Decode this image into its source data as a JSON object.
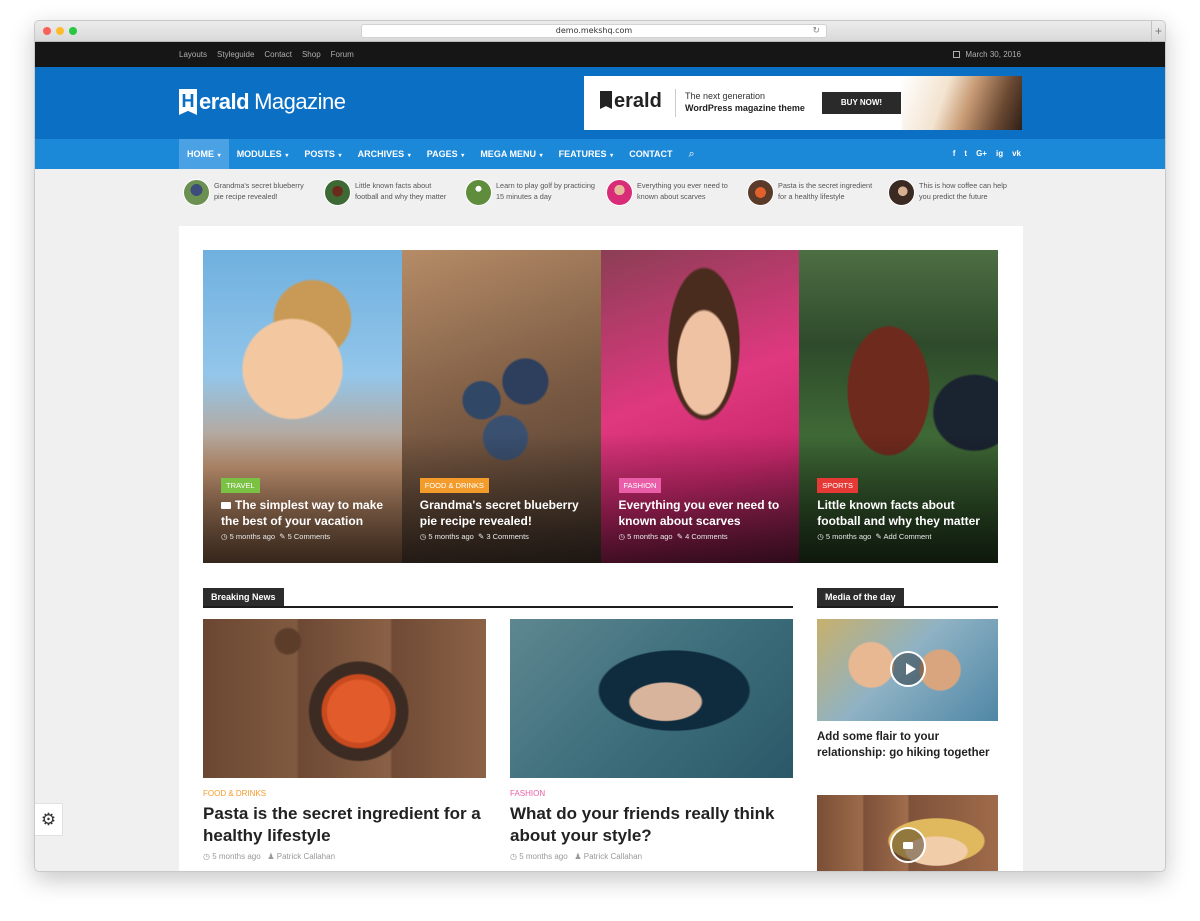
{
  "browser": {
    "url": "demo.mekshq.com"
  },
  "topbar": {
    "links": [
      "Layouts",
      "Styleguide",
      "Contact",
      "Shop",
      "Forum"
    ],
    "date": "March 30, 2016"
  },
  "logo": {
    "mark": "H",
    "word": "erald",
    "suffix": "Magazine"
  },
  "banner": {
    "logo_text": "erald",
    "tagline_1": "The next generation",
    "tagline_2": "WordPress magazine theme",
    "button": "BUY NOW!"
  },
  "nav": {
    "items": [
      "HOME",
      "MODULES",
      "POSTS",
      "ARCHIVES",
      "PAGES",
      "MEGA MENU",
      "FEATURES",
      "CONTACT"
    ],
    "social": [
      "f",
      "t",
      "G+",
      "ig",
      "vk"
    ]
  },
  "ticker": [
    "Grandma's secret blueberry pie recipe revealed!",
    "Little known facts about football and why they matter",
    "Learn to play golf by practicing 15 minutes a day",
    "Everything you ever need to known about scarves",
    "Pasta is the secret ingredient for a healthy lifestyle",
    "This is how coffee can help you predict the future"
  ],
  "featured": [
    {
      "category": "TRAVEL",
      "title": "The simplest way to make the best of your vacation",
      "time": "5 months ago",
      "comments": "5 Comments"
    },
    {
      "category": "FOOD & DRINKS",
      "title": "Grandma's secret blueberry pie recipe revealed!",
      "time": "5 months ago",
      "comments": "3 Comments"
    },
    {
      "category": "FASHION",
      "title": "Everything you ever need to known about scarves",
      "time": "5 months ago",
      "comments": "4 Comments"
    },
    {
      "category": "SPORTS",
      "title": "Little known facts about football and why they matter",
      "time": "5 months ago",
      "comments": "Add Comment"
    }
  ],
  "breaking": {
    "heading": "Breaking News",
    "posts": [
      {
        "category": "FOOD & DRINKS",
        "title": "Pasta is the secret ingredient for a healthy lifestyle",
        "time": "5 months ago",
        "author": "Patrick Callahan"
      },
      {
        "category": "FASHION",
        "title": "What do your friends really think about your style?",
        "time": "5 months ago",
        "author": "Patrick Callahan"
      }
    ]
  },
  "media": {
    "heading": "Media of the day",
    "items": [
      {
        "title": "Add some flair to your relationship: go hiking together"
      }
    ]
  },
  "colors": {
    "primary": "#0b6fc4",
    "nav": "#1c88d8",
    "travel": "#7bc144",
    "food": "#f39c2c",
    "fashion": "#ea5da8",
    "sports": "#e53935"
  }
}
